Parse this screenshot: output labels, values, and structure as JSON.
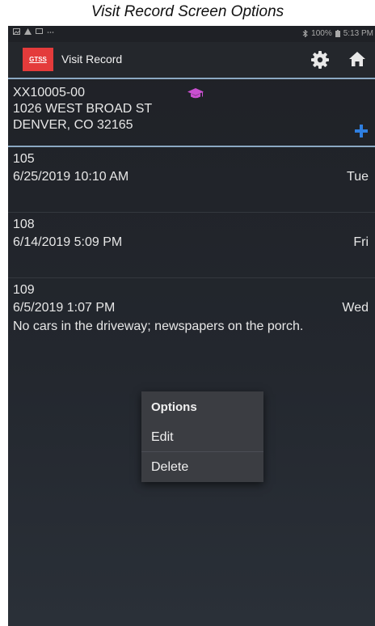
{
  "caption": "Visit Record Screen Options",
  "status_bar": {
    "battery": "100%",
    "time": "5:13 PM"
  },
  "app_bar": {
    "logo_text": "GTSS",
    "title": "Visit Record",
    "icons": [
      "gear-icon",
      "home-icon"
    ]
  },
  "account": {
    "number": "XX10005-00",
    "address_line1": "1026 WEST BROAD ST",
    "address_line2": "DENVER, CO 32165",
    "icons": [
      "graduation-cap-icon",
      "plus-icon"
    ]
  },
  "visits": [
    {
      "id": "105",
      "datetime": "6/25/2019  10:10 AM",
      "day": "Tue",
      "note": ""
    },
    {
      "id": "108",
      "datetime": "6/14/2019  5:09 PM",
      "day": "Fri",
      "note": ""
    },
    {
      "id": "109",
      "datetime": "6/5/2019  1:07 PM",
      "day": "Wed",
      "note": "No cars in the driveway; newspapers on the porch."
    }
  ],
  "menu": {
    "title": "Options",
    "items": [
      "Edit",
      "Delete"
    ]
  },
  "colors": {
    "background": "#23272e",
    "accent_line": "#8ba8c2",
    "logo": "#e43b3b",
    "plus": "#2f7fe0",
    "grad_cap": "#c94fd0"
  }
}
